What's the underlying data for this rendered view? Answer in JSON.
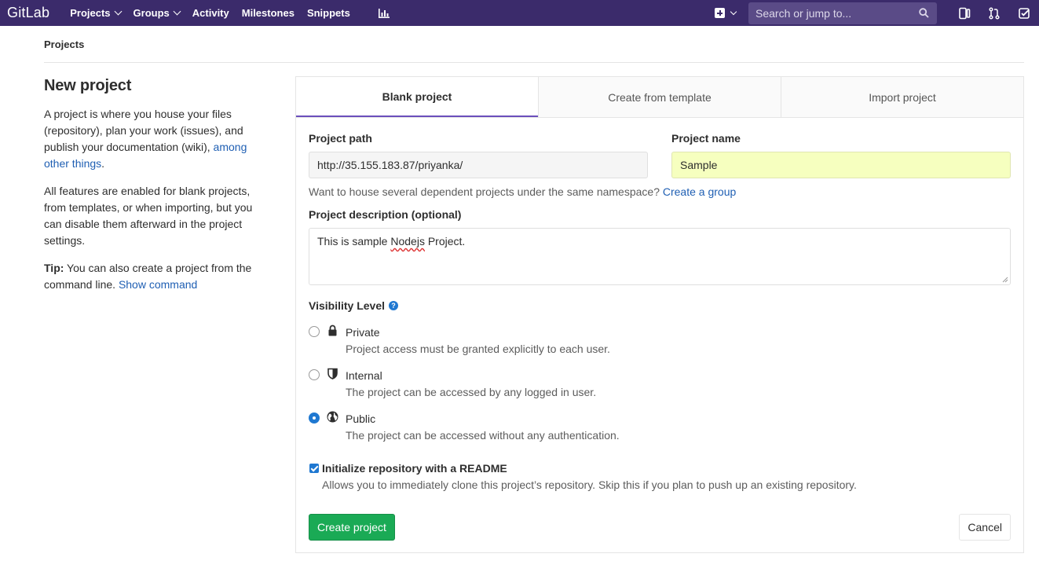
{
  "navbar": {
    "logo": "GitLab",
    "links": [
      {
        "label": "Projects"
      },
      {
        "label": "Groups"
      },
      {
        "label": "Activity"
      },
      {
        "label": "Milestones"
      },
      {
        "label": "Snippets"
      }
    ],
    "search_placeholder": "Search or jump to...",
    "bg_color": "#3b2b6b"
  },
  "breadcrumb": "Projects",
  "sidebar": {
    "title": "New project",
    "p1_text": "A project is where you house your files (repository), plan your work (issues), and publish your documentation (wiki),",
    "p1_link": "among other things",
    "p1_end": ".",
    "p2_text": "All features are enabled for blank projects, from templates, or when importing, but you can disable them afterward in the project settings.",
    "p3_bold": "Tip:",
    "p3_text": "You can also create a project from the command line.",
    "p3_link": "Show command"
  },
  "tabs": [
    {
      "label": "Blank project",
      "active": true
    },
    {
      "label": "Create from template",
      "active": false
    },
    {
      "label": "Import project",
      "active": false
    }
  ],
  "form": {
    "path_label": "Project path",
    "path_value": "http://35.155.183.87/priyanka/",
    "name_label": "Project name",
    "name_value": "Sample",
    "namespace_help": "Want to house several dependent projects under the same namespace?",
    "namespace_link": "Create a group",
    "desc_label": "Project description (optional)",
    "desc_value_before": "This is sample ",
    "desc_value_misspelled": "Nodejs",
    "desc_value_after": " Project.",
    "visibility_label": "Visibility Level",
    "visibility_help_icon": "?",
    "visibility": [
      {
        "name": "Private",
        "desc": "Project access must be granted explicitly to each user.",
        "icon": "lock-icon",
        "checked": false
      },
      {
        "name": "Internal",
        "desc": "The project can be accessed by any logged in user.",
        "icon": "shield-icon",
        "checked": false
      },
      {
        "name": "Public",
        "desc": "The project can be accessed without any authentication.",
        "icon": "globe-icon",
        "checked": true
      }
    ],
    "readme_title": "Initialize repository with a README",
    "readme_desc": "Allows you to immediately clone this project’s repository. Skip this if you plan to push up an existing repository.",
    "readme_checked": true,
    "create_label": "Create project",
    "cancel_label": "Cancel"
  }
}
